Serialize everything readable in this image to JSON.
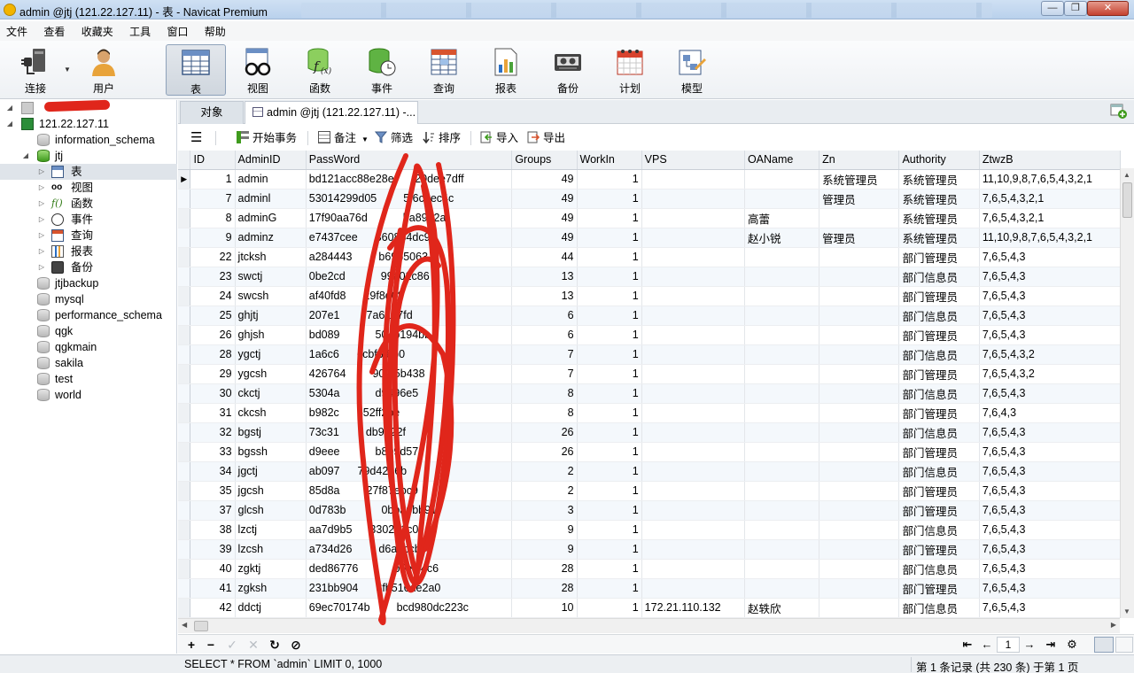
{
  "window": {
    "title": "admin @jtj (121.22.127.11) - 表 - Navicat Premium",
    "minimize_glyph": "—",
    "maximize_glyph": "❐",
    "close_glyph": "✕"
  },
  "menu": [
    "文件",
    "查看",
    "收藏夹",
    "工具",
    "窗口",
    "帮助"
  ],
  "toolbar": [
    {
      "label": "连接",
      "icon": "plug-icon"
    },
    {
      "label": "用户",
      "icon": "user-icon"
    },
    {
      "label": "表",
      "icon": "table-icon",
      "active": true
    },
    {
      "label": "视图",
      "icon": "view-glasses-icon"
    },
    {
      "label": "函数",
      "icon": "function-icon"
    },
    {
      "label": "事件",
      "icon": "event-icon"
    },
    {
      "label": "查询",
      "icon": "query-icon"
    },
    {
      "label": "报表",
      "icon": "report-icon"
    },
    {
      "label": "备份",
      "icon": "backup-icon"
    },
    {
      "label": "计划",
      "icon": "schedule-icon"
    },
    {
      "label": "模型",
      "icon": "model-icon"
    }
  ],
  "nav": {
    "connection": "121.22.127.11",
    "databases": [
      "information_schema",
      "jtj"
    ],
    "jtj_children": [
      "表",
      "视图",
      "函数",
      "事件",
      "查询",
      "报表",
      "备份"
    ],
    "more_databases": [
      "jtjbackup",
      "mysql",
      "performance_schema",
      "qgk",
      "qgkmain",
      "sakila",
      "test",
      "world"
    ]
  },
  "tabs": {
    "objects": "对象",
    "table_tab": "admin @jtj (121.22.127.11) -..."
  },
  "grid_toolbar": {
    "menu_glyph": "☰",
    "begin_transaction": "开始事务",
    "memo": "备注",
    "filter": "筛选",
    "sort": "排序",
    "import": "导入",
    "export": "导出"
  },
  "grid": {
    "columns": [
      "ID",
      "AdminID",
      "PassWord",
      "Groups",
      "WorkIn",
      "VPS",
      "OAName",
      "Zn",
      "Authority",
      "ZtwzB"
    ],
    "rows": [
      [
        "1",
        "admin",
        "bd121acc88e28e",
        "49",
        "1",
        "",
        "",
        "系统管理员",
        "系统管理员",
        "11,10,9,8,7,6,5,4,3,2,1"
      ],
      [
        "7",
        "adminl",
        "53014299d05",
        "49",
        "1",
        "",
        "",
        "管理员",
        "系统管理员",
        "7,6,5,4,3,2,1"
      ],
      [
        "8",
        "adminG",
        "17f90aa76d",
        "49",
        "1",
        "",
        "高蕾",
        "",
        "系统管理员",
        "7,6,5,4,3,2,1"
      ],
      [
        "9",
        "adminz",
        "e7437cee",
        "49",
        "1",
        "",
        "赵小锐",
        "管理员",
        "系统管理员",
        "11,10,9,8,7,6,5,4,3,2,1"
      ],
      [
        "22",
        "jtcksh",
        "a284443",
        "44",
        "1",
        "",
        "",
        "",
        "部门管理员",
        "7,6,5,4,3"
      ],
      [
        "23",
        "swctj",
        "0be2cd",
        "13",
        "1",
        "",
        "",
        "",
        "部门信息员",
        "7,6,5,4,3"
      ],
      [
        "24",
        "swcsh",
        "af40fd8",
        "13",
        "1",
        "",
        "",
        "",
        "部门管理员",
        "7,6,5,4,3"
      ],
      [
        "25",
        "ghjtj",
        "207e1",
        "6",
        "1",
        "",
        "",
        "",
        "部门信息员",
        "7,6,5,4,3"
      ],
      [
        "26",
        "ghjsh",
        "bd089",
        "6",
        "1",
        "",
        "",
        "",
        "部门管理员",
        "7,6,5,4,3"
      ],
      [
        "28",
        "ygctj",
        "1a6c6",
        "7",
        "1",
        "",
        "",
        "",
        "部门信息员",
        "7,6,5,4,3,2"
      ],
      [
        "29",
        "ygcsh",
        "426764",
        "7",
        "1",
        "",
        "",
        "",
        "部门管理员",
        "7,6,5,4,3,2"
      ],
      [
        "30",
        "ckctj",
        "5304a",
        "8",
        "1",
        "",
        "",
        "",
        "部门信息员",
        "7,6,5,4,3"
      ],
      [
        "31",
        "ckcsh",
        "b982c",
        "8",
        "1",
        "",
        "",
        "",
        "部门管理员",
        "7,6,4,3"
      ],
      [
        "32",
        "bgstj",
        "73c31",
        "26",
        "1",
        "",
        "",
        "",
        "部门信息员",
        "7,6,5,4,3"
      ],
      [
        "33",
        "bgssh",
        "d9eee",
        "26",
        "1",
        "",
        "",
        "",
        "部门管理员",
        "7,6,5,4,3"
      ],
      [
        "34",
        "jgctj",
        "ab097",
        "2",
        "1",
        "",
        "",
        "",
        "部门信息员",
        "7,6,5,4,3"
      ],
      [
        "35",
        "jgcsh",
        "85d8a",
        "2",
        "1",
        "",
        "",
        "",
        "部门管理员",
        "7,6,5,4,3"
      ],
      [
        "37",
        "glcsh",
        "0d783b",
        "3",
        "1",
        "",
        "",
        "",
        "部门管理员",
        "7,6,5,4,3"
      ],
      [
        "38",
        "lzctj",
        "aa7d9b5",
        "9",
        "1",
        "",
        "",
        "",
        "部门信息员",
        "7,6,5,4,3"
      ],
      [
        "39",
        "lzcsh",
        "a734d26",
        "9",
        "1",
        "",
        "",
        "",
        "部门管理员",
        "7,6,5,4,3"
      ],
      [
        "40",
        "zgktj",
        "ded86776",
        "28",
        "1",
        "",
        "",
        "",
        "部门信息员",
        "7,6,5,4,3"
      ],
      [
        "41",
        "zgksh",
        "231bb904",
        "28",
        "1",
        "",
        "",
        "",
        "部门管理员",
        "7,6,5,4,3"
      ],
      [
        "42",
        "ddctj",
        "69ec70174b",
        "10",
        "1",
        "172.21.110.132",
        "赵轶欣",
        "",
        "部门信息员",
        "7,6,5,4,3"
      ]
    ],
    "password_tails": [
      "f20dee7dff",
      "5f6c3ec4c",
      "ba89a2a",
      "360884dc9",
      "b69b5063",
      "99a02c86",
      "29f8d08",
      "7a6237fd",
      "504b194bb",
      "ccbf6f8b0",
      "902f5b438",
      "d9496e5",
      "652ff2be",
      "db9322f",
      "b809d57",
      "79d4286b",
      "27f87ebc9",
      "0bba6bb91",
      "330201c0",
      "d6a7ccb5",
      "b5efc4c6",
      "8fb516de2a0",
      "bcd980dc223c"
    ],
    "current_row_marker": "▶"
  },
  "bottom_bar": {
    "add": "+",
    "remove": "−",
    "apply": "✓",
    "discard": "✕",
    "refresh": "↻",
    "stop": "⊘",
    "first": "⇤",
    "prev": "←",
    "page": "1",
    "next": "→",
    "last": "⇥",
    "settings": "⚙"
  },
  "status": {
    "sql": "SELECT * FROM `admin` LIMIT 0, 1000",
    "record_info": "第 1 条记录 (共 230 条) 于第 1 页"
  },
  "colors": {
    "scribble": "#e0261b",
    "selected_row": "#dfe4ea",
    "accent_green": "#3f9b1d"
  }
}
